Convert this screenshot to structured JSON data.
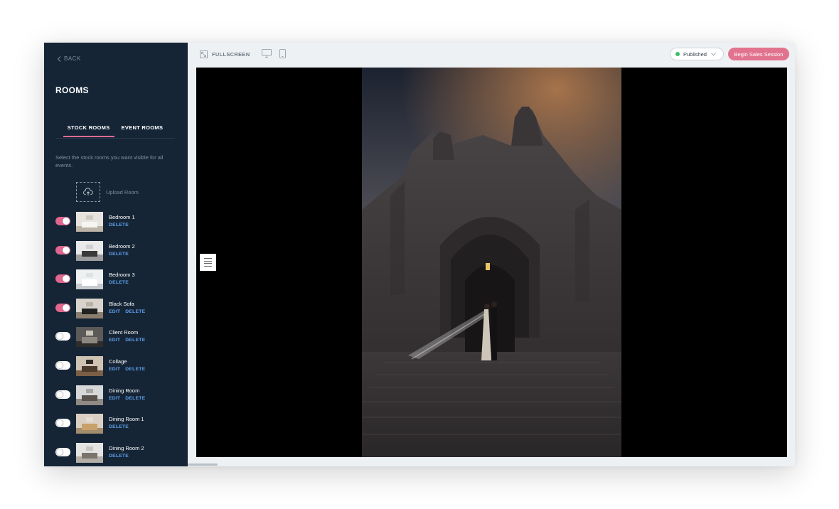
{
  "sidebar": {
    "back_label": "BACK",
    "title": "ROOMS",
    "tabs": [
      {
        "label": "STOCK ROOMS",
        "active": true
      },
      {
        "label": "EVENT ROOMS",
        "active": false
      }
    ],
    "description": "Select the stock rooms you want visible for all events.",
    "upload_label": "Upload Room",
    "rooms": [
      {
        "name": "Bedroom 1",
        "enabled": true,
        "edit": "",
        "delete": "DELETE",
        "thumb": {
          "wall": "#e7e4df",
          "floor": "#bdb4a8",
          "furn": "#f6f5f2",
          "art": "#cfc9c0"
        }
      },
      {
        "name": "Bedroom 2",
        "enabled": true,
        "edit": "",
        "delete": "DELETE",
        "thumb": {
          "wall": "#e9e9e9",
          "floor": "#9c9c9c",
          "furn": "#3a3a3a",
          "art": "#d0d0d0"
        }
      },
      {
        "name": "Bedroom 3",
        "enabled": true,
        "edit": "",
        "delete": "DELETE",
        "thumb": {
          "wall": "#eef0f1",
          "floor": "#c8cbcd",
          "furn": "#ffffff",
          "art": "#dfe2e4"
        }
      },
      {
        "name": "Black Sofa",
        "enabled": true,
        "edit": "EDIT",
        "delete": "DELETE",
        "thumb": {
          "wall": "#d8d3cc",
          "floor": "#8b7e70",
          "furn": "#222222",
          "art": "#b9b0a6"
        }
      },
      {
        "name": "Client Room",
        "enabled": false,
        "edit": "EDIT",
        "delete": "DELETE",
        "thumb": {
          "wall": "#5b5a58",
          "floor": "#2f2d2b",
          "furn": "#8c8880",
          "art": "#c9c2b7"
        }
      },
      {
        "name": "Collage",
        "enabled": false,
        "edit": "EDIT",
        "delete": "DELETE",
        "thumb": {
          "wall": "#cfc4b3",
          "floor": "#7a5e45",
          "furn": "#4a3b2e",
          "art": "#2f2a26"
        }
      },
      {
        "name": "Dining Room",
        "enabled": false,
        "edit": "EDIT",
        "delete": "DELETE",
        "thumb": {
          "wall": "#d5d7d8",
          "floor": "#8f8a84",
          "furn": "#5a524c",
          "art": "#a9a6a2"
        }
      },
      {
        "name": "Dining Room 1",
        "enabled": false,
        "edit": "",
        "delete": "DELETE",
        "thumb": {
          "wall": "#d9d0c3",
          "floor": "#a48c6e",
          "furn": "#c8a16a",
          "art": "#e4ddd3"
        }
      },
      {
        "name": "Dining Room 2",
        "enabled": false,
        "edit": "",
        "delete": "DELETE",
        "thumb": {
          "wall": "#e4e4e2",
          "floor": "#b3aea7",
          "furn": "#7a746d",
          "art": "#c9c6c2"
        }
      }
    ]
  },
  "toolbar": {
    "fullscreen_label": "FULLSCREEN",
    "desktop_icon": "desktop-icon",
    "mobile_icon": "mobile-icon",
    "status_label": "Published",
    "status_color": "#3fbf6a",
    "begin_label": "Begin Sales Session",
    "accent_color": "#e2738f"
  }
}
